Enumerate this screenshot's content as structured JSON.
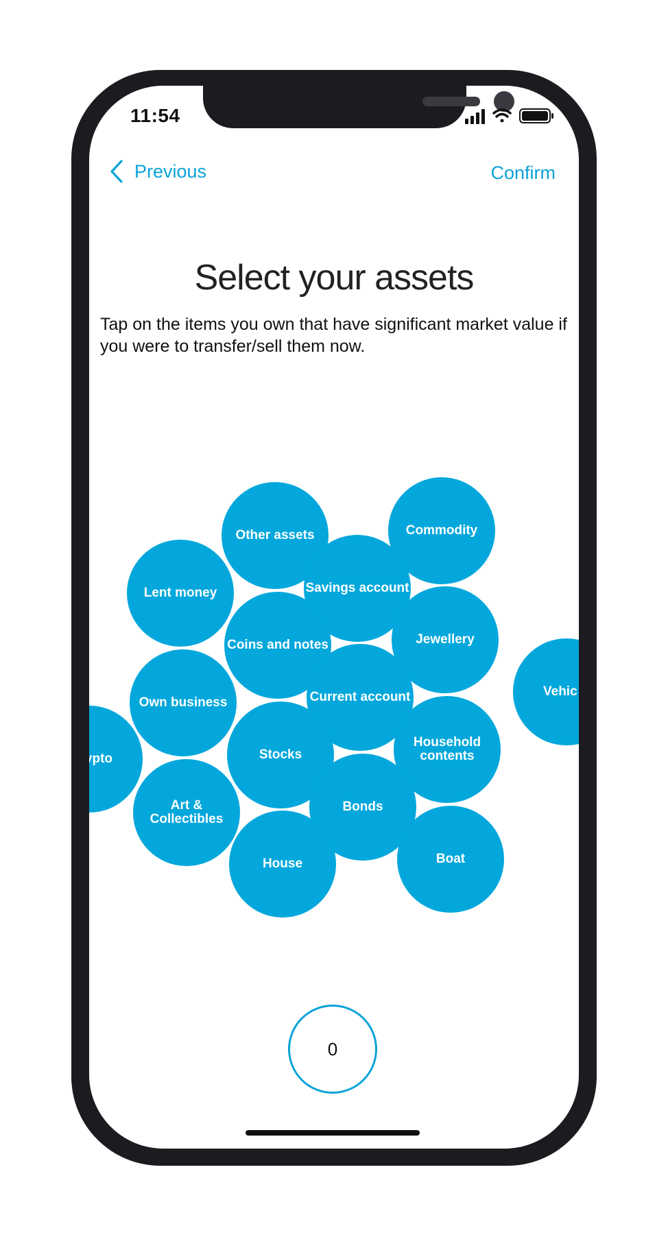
{
  "status_bar": {
    "time": "11:54",
    "icons": [
      "signal-icon",
      "wifi-icon",
      "battery-icon"
    ]
  },
  "nav": {
    "previous_label": "Previous",
    "confirm_label": "Confirm",
    "accent_color": "#0aa3d8"
  },
  "page": {
    "title": "Select your assets",
    "subtitle": "Tap on the items you own that have significant market value if you were to transfer/sell them now."
  },
  "assets": {
    "bubble_color": "#03a7dc",
    "items": [
      {
        "label": "Other assets"
      },
      {
        "label": "Commodity"
      },
      {
        "label": "Lent money"
      },
      {
        "label": "Savings account"
      },
      {
        "label": "Coins and notes"
      },
      {
        "label": "Jewellery"
      },
      {
        "label": "Vehic"
      },
      {
        "label": "Own business"
      },
      {
        "label": "Current account"
      },
      {
        "label": "ypto"
      },
      {
        "label": "Stocks"
      },
      {
        "label": "Household\ncontents"
      },
      {
        "label": "Art &\nCollectibles"
      },
      {
        "label": "Bonds"
      },
      {
        "label": "House"
      },
      {
        "label": "Boat"
      }
    ]
  },
  "selected_count": "0"
}
